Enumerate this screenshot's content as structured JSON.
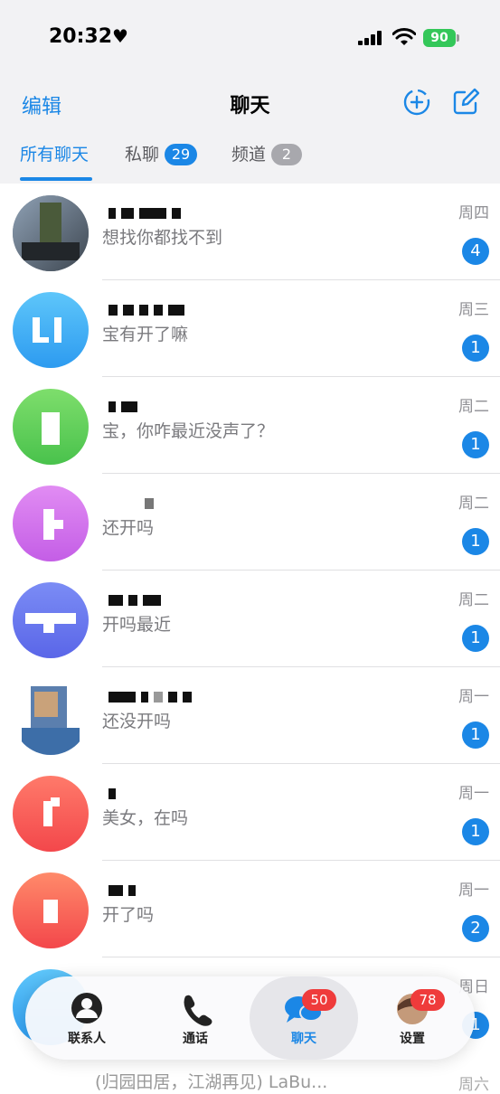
{
  "status_bar": {
    "time": "20:32",
    "battery": "90"
  },
  "nav": {
    "edit": "编辑",
    "title": "聊天"
  },
  "tabs": [
    {
      "label": "所有聊天"
    },
    {
      "label": "私聊",
      "badge": "29"
    },
    {
      "label": "频道",
      "badge": "2"
    }
  ],
  "chats": [
    {
      "preview": "想找你都找不到",
      "day": "周四",
      "unread": "4"
    },
    {
      "preview": "宝有开了嘛",
      "day": "周三",
      "unread": "1"
    },
    {
      "preview": "宝，你咋最近没声了？",
      "day": "周二",
      "unread": "1"
    },
    {
      "preview": "还开吗",
      "day": "周二",
      "unread": "1"
    },
    {
      "preview": "开吗最近",
      "day": "周二",
      "unread": "1"
    },
    {
      "preview": "还没开吗",
      "day": "周一",
      "unread": "1"
    },
    {
      "preview": "美女，在吗",
      "day": "周一",
      "unread": "1"
    },
    {
      "preview": "开了吗",
      "day": "周一",
      "unread": "2"
    },
    {
      "preview": "",
      "day": "周日",
      "unread": "1"
    }
  ],
  "partial_row": {
    "preview": "(归园田居，江湖再见) LaBu...",
    "day": "周六"
  },
  "tabbar": [
    {
      "label": "联系人"
    },
    {
      "label": "通话"
    },
    {
      "label": "聊天",
      "badge": "50"
    },
    {
      "label": "设置",
      "badge": "78"
    }
  ],
  "colors": {
    "accent": "#1b87e6",
    "badge_red": "#ef3b3b"
  }
}
